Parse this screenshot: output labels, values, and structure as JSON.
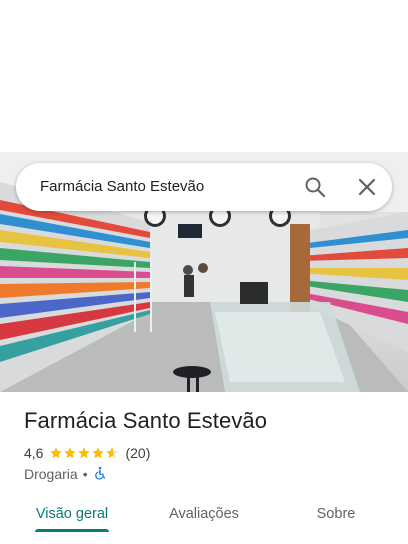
{
  "search": {
    "query": "Farmácia Santo Estevão"
  },
  "photo": {
    "subject": "pharmacy-interior-photo"
  },
  "place": {
    "name": "Farmácia Santo Estevão",
    "rating": "4,6",
    "rating_value": 4.6,
    "reviews": "(20)",
    "category": "Drogaria",
    "separator": "•",
    "accessibility_icon": "wheelchair-icon"
  },
  "tabs": [
    {
      "label": "Visão geral",
      "active": true
    },
    {
      "label": "Avaliações",
      "active": false
    },
    {
      "label": "Sobre",
      "active": false
    }
  ],
  "colors": {
    "accent": "#0b7a75",
    "star": "#fbbc04",
    "access": "#1a73e8"
  }
}
